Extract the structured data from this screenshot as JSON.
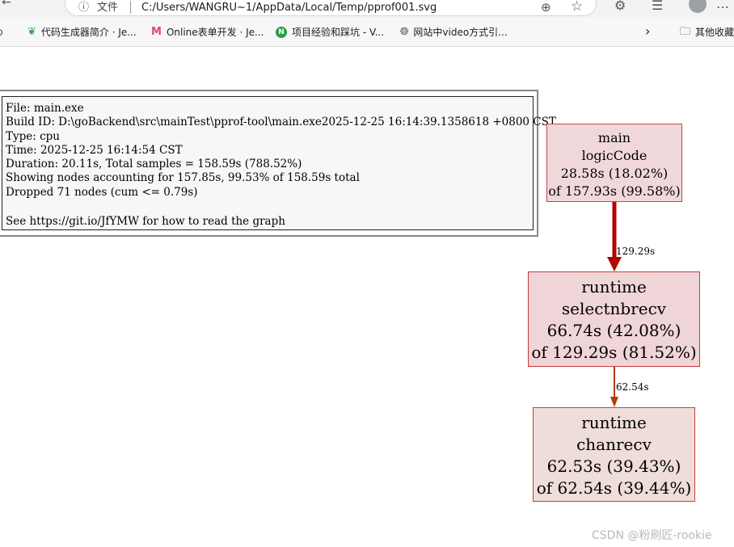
{
  "browser": {
    "address_scheme": "文件",
    "address_url": "C:/Users/WANGRU~1/AppData/Local/Temp/pprof001.svg",
    "bookmarks": [
      {
        "label": "代码生成器简介 · Je...",
        "icon": "leaf-icon"
      },
      {
        "label": "Online表单开发 · Je...",
        "icon": "m-logo-icon"
      },
      {
        "label": "项目经验和踩坑 - V...",
        "icon": "n-logo-icon",
        "icon_text": "N"
      },
      {
        "label": "网站中video方式引...",
        "icon": "globe-icon"
      }
    ],
    "other_bookmarks": "其他收藏"
  },
  "graph": {
    "legend": [
      "File: main.exe",
      "Build ID: D:\\goBackend\\src\\mainTest\\pprof-tool\\main.exe2025-12-25 16:14:39.1358618 +0800 CST",
      "Type: cpu",
      "Time: 2025-12-25 16:14:54 CST",
      "Duration: 20.11s, Total samples = 158.59s (788.52%)",
      "Showing nodes accounting for 157.85s, 99.53% of 158.59s total",
      "Dropped 71 nodes (cum <= 0.79s)",
      "See https://git.io/JfYMW for how to read the graph"
    ],
    "nodes": [
      {
        "package": "main",
        "func": "logicCode",
        "flat": "28.58s (18.02%)",
        "cum": "of 157.93s (99.58%)"
      },
      {
        "package": "runtime",
        "func": "selectnbrecv",
        "flat": "66.74s (42.08%)",
        "cum": "of 129.29s (81.52%)"
      },
      {
        "package": "runtime",
        "func": "chanrecv",
        "flat": "62.53s (39.43%)",
        "cum": "of 62.54s (39.44%)"
      }
    ],
    "edges": [
      {
        "label": "129.29s",
        "color": "#b20400"
      },
      {
        "label": "62.54s",
        "color": "#b23c00"
      }
    ]
  },
  "watermark": "CSDN @粉刷匠-rookie"
}
